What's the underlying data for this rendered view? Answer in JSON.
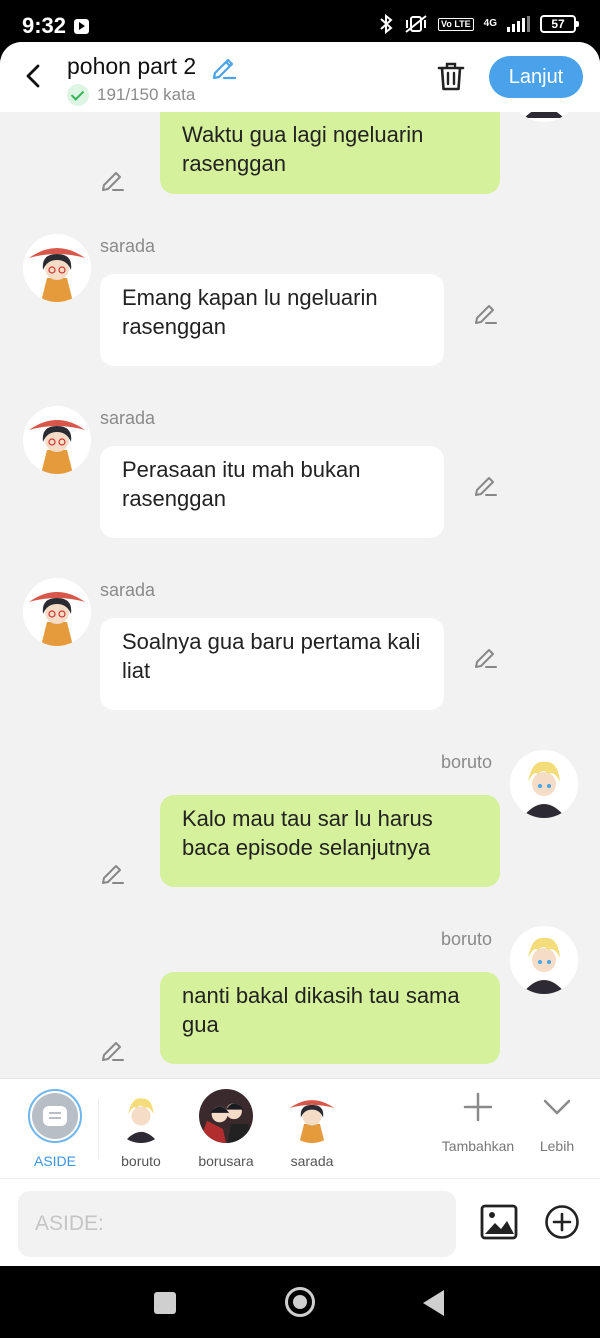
{
  "status_bar": {
    "time": "9:32",
    "network": "4G",
    "lte_label": "Vo LTE",
    "battery": "57"
  },
  "header": {
    "title": "pohon part 2",
    "word_count": "191/150 kata",
    "next_label": "Lanjut"
  },
  "messages": [
    {
      "side": "right",
      "sender": "",
      "text": "Waktu gua lagi ngeluarin rasenggan"
    },
    {
      "side": "left",
      "sender": "sarada",
      "text": "Emang kapan lu ngeluarin rasenggan"
    },
    {
      "side": "left",
      "sender": "sarada",
      "text": "Perasaan itu mah bukan rasenggan"
    },
    {
      "side": "left",
      "sender": "sarada",
      "text": "Soalnya gua baru pertama kali liat"
    },
    {
      "side": "right",
      "sender": "boruto",
      "text": "Kalo mau tau sar lu harus baca episode selanjutnya"
    },
    {
      "side": "right",
      "sender": "boruto",
      "text": "nanti bakal dikasih tau sama gua"
    }
  ],
  "characters": [
    {
      "name": "ASIDE",
      "active": true
    },
    {
      "name": "boruto"
    },
    {
      "name": "borusara"
    },
    {
      "name": "sarada"
    }
  ],
  "tools": {
    "add_label": "Tambahkan",
    "more_label": "Lebih"
  },
  "input": {
    "placeholder": "ASIDE:"
  },
  "colors": {
    "accent": "#4aa3ea",
    "bubble_right": "#d5f19b",
    "bubble_left": "#ffffff",
    "background": "#f2f2f2"
  }
}
